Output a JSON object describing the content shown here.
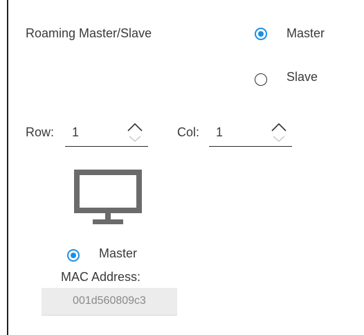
{
  "roaming": {
    "label": "Roaming Master/Slave",
    "options": [
      {
        "label": "Master",
        "selected": true
      },
      {
        "label": "Slave",
        "selected": false
      }
    ]
  },
  "position": {
    "row_label": "Row:",
    "row_value": "1",
    "col_label": "Col:",
    "col_value": "1"
  },
  "device": {
    "icon": "monitor-icon",
    "role_label": "Master",
    "role_selected": true,
    "mac_label": "MAC Address:",
    "mac_value": "001d560809c3"
  },
  "colors": {
    "accent": "#1a8fe3",
    "text": "#3a3a3a",
    "icon": "#6b6b6b",
    "mac_bg": "#ececec"
  }
}
